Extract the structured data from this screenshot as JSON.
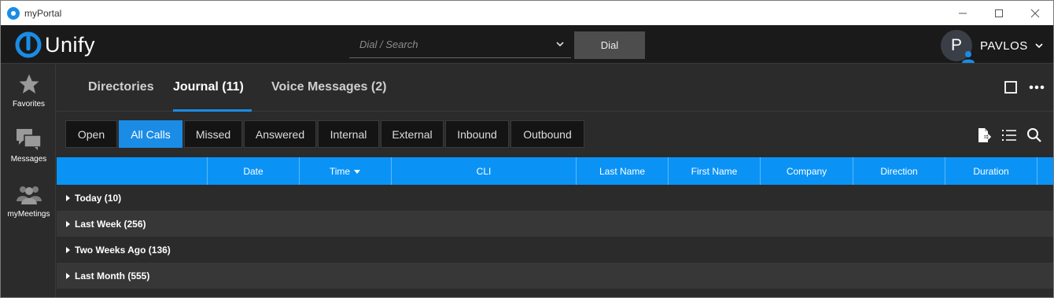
{
  "window": {
    "title": "myPortal",
    "controls": [
      "minimize",
      "maximize",
      "close"
    ]
  },
  "header": {
    "logo_text": "Unify",
    "search_placeholder": "Dial / Search",
    "dial_label": "Dial",
    "user_initial": "P",
    "user_name": "PAVLOS"
  },
  "sidebar": {
    "items": [
      {
        "label": "Favorites",
        "icon": "star-icon"
      },
      {
        "label": "Messages",
        "icon": "chat-bubbles-icon"
      },
      {
        "label": "myMeetings",
        "icon": "group-icon"
      }
    ]
  },
  "tabs": [
    {
      "label": "Directories",
      "active": false
    },
    {
      "label": "Journal (11)",
      "active": true
    },
    {
      "label": "Voice Messages (2)",
      "active": false
    }
  ],
  "filters": [
    {
      "label": "Open",
      "active": false
    },
    {
      "label": "All Calls",
      "active": true
    },
    {
      "label": "Missed",
      "active": false
    },
    {
      "label": "Answered",
      "active": false
    },
    {
      "label": "Internal",
      "active": false
    },
    {
      "label": "External",
      "active": false
    },
    {
      "label": "Inbound",
      "active": false
    },
    {
      "label": "Outbound",
      "active": false
    }
  ],
  "grid": {
    "columns": [
      "",
      "Date",
      "Time",
      "CLI",
      "Last Name",
      "First Name",
      "Company",
      "Direction",
      "Duration",
      ""
    ],
    "sort_column": "Time",
    "groups": [
      {
        "label": "Today (10)"
      },
      {
        "label": "Last Week (256)"
      },
      {
        "label": "Two Weeks Ago (136)"
      },
      {
        "label": "Last Month (555)"
      }
    ]
  },
  "colors": {
    "accent": "#1a8ce6",
    "header_bg": "#1a1a1a",
    "grid_header": "#0a93f5",
    "body_bg": "#2b2b2b"
  }
}
